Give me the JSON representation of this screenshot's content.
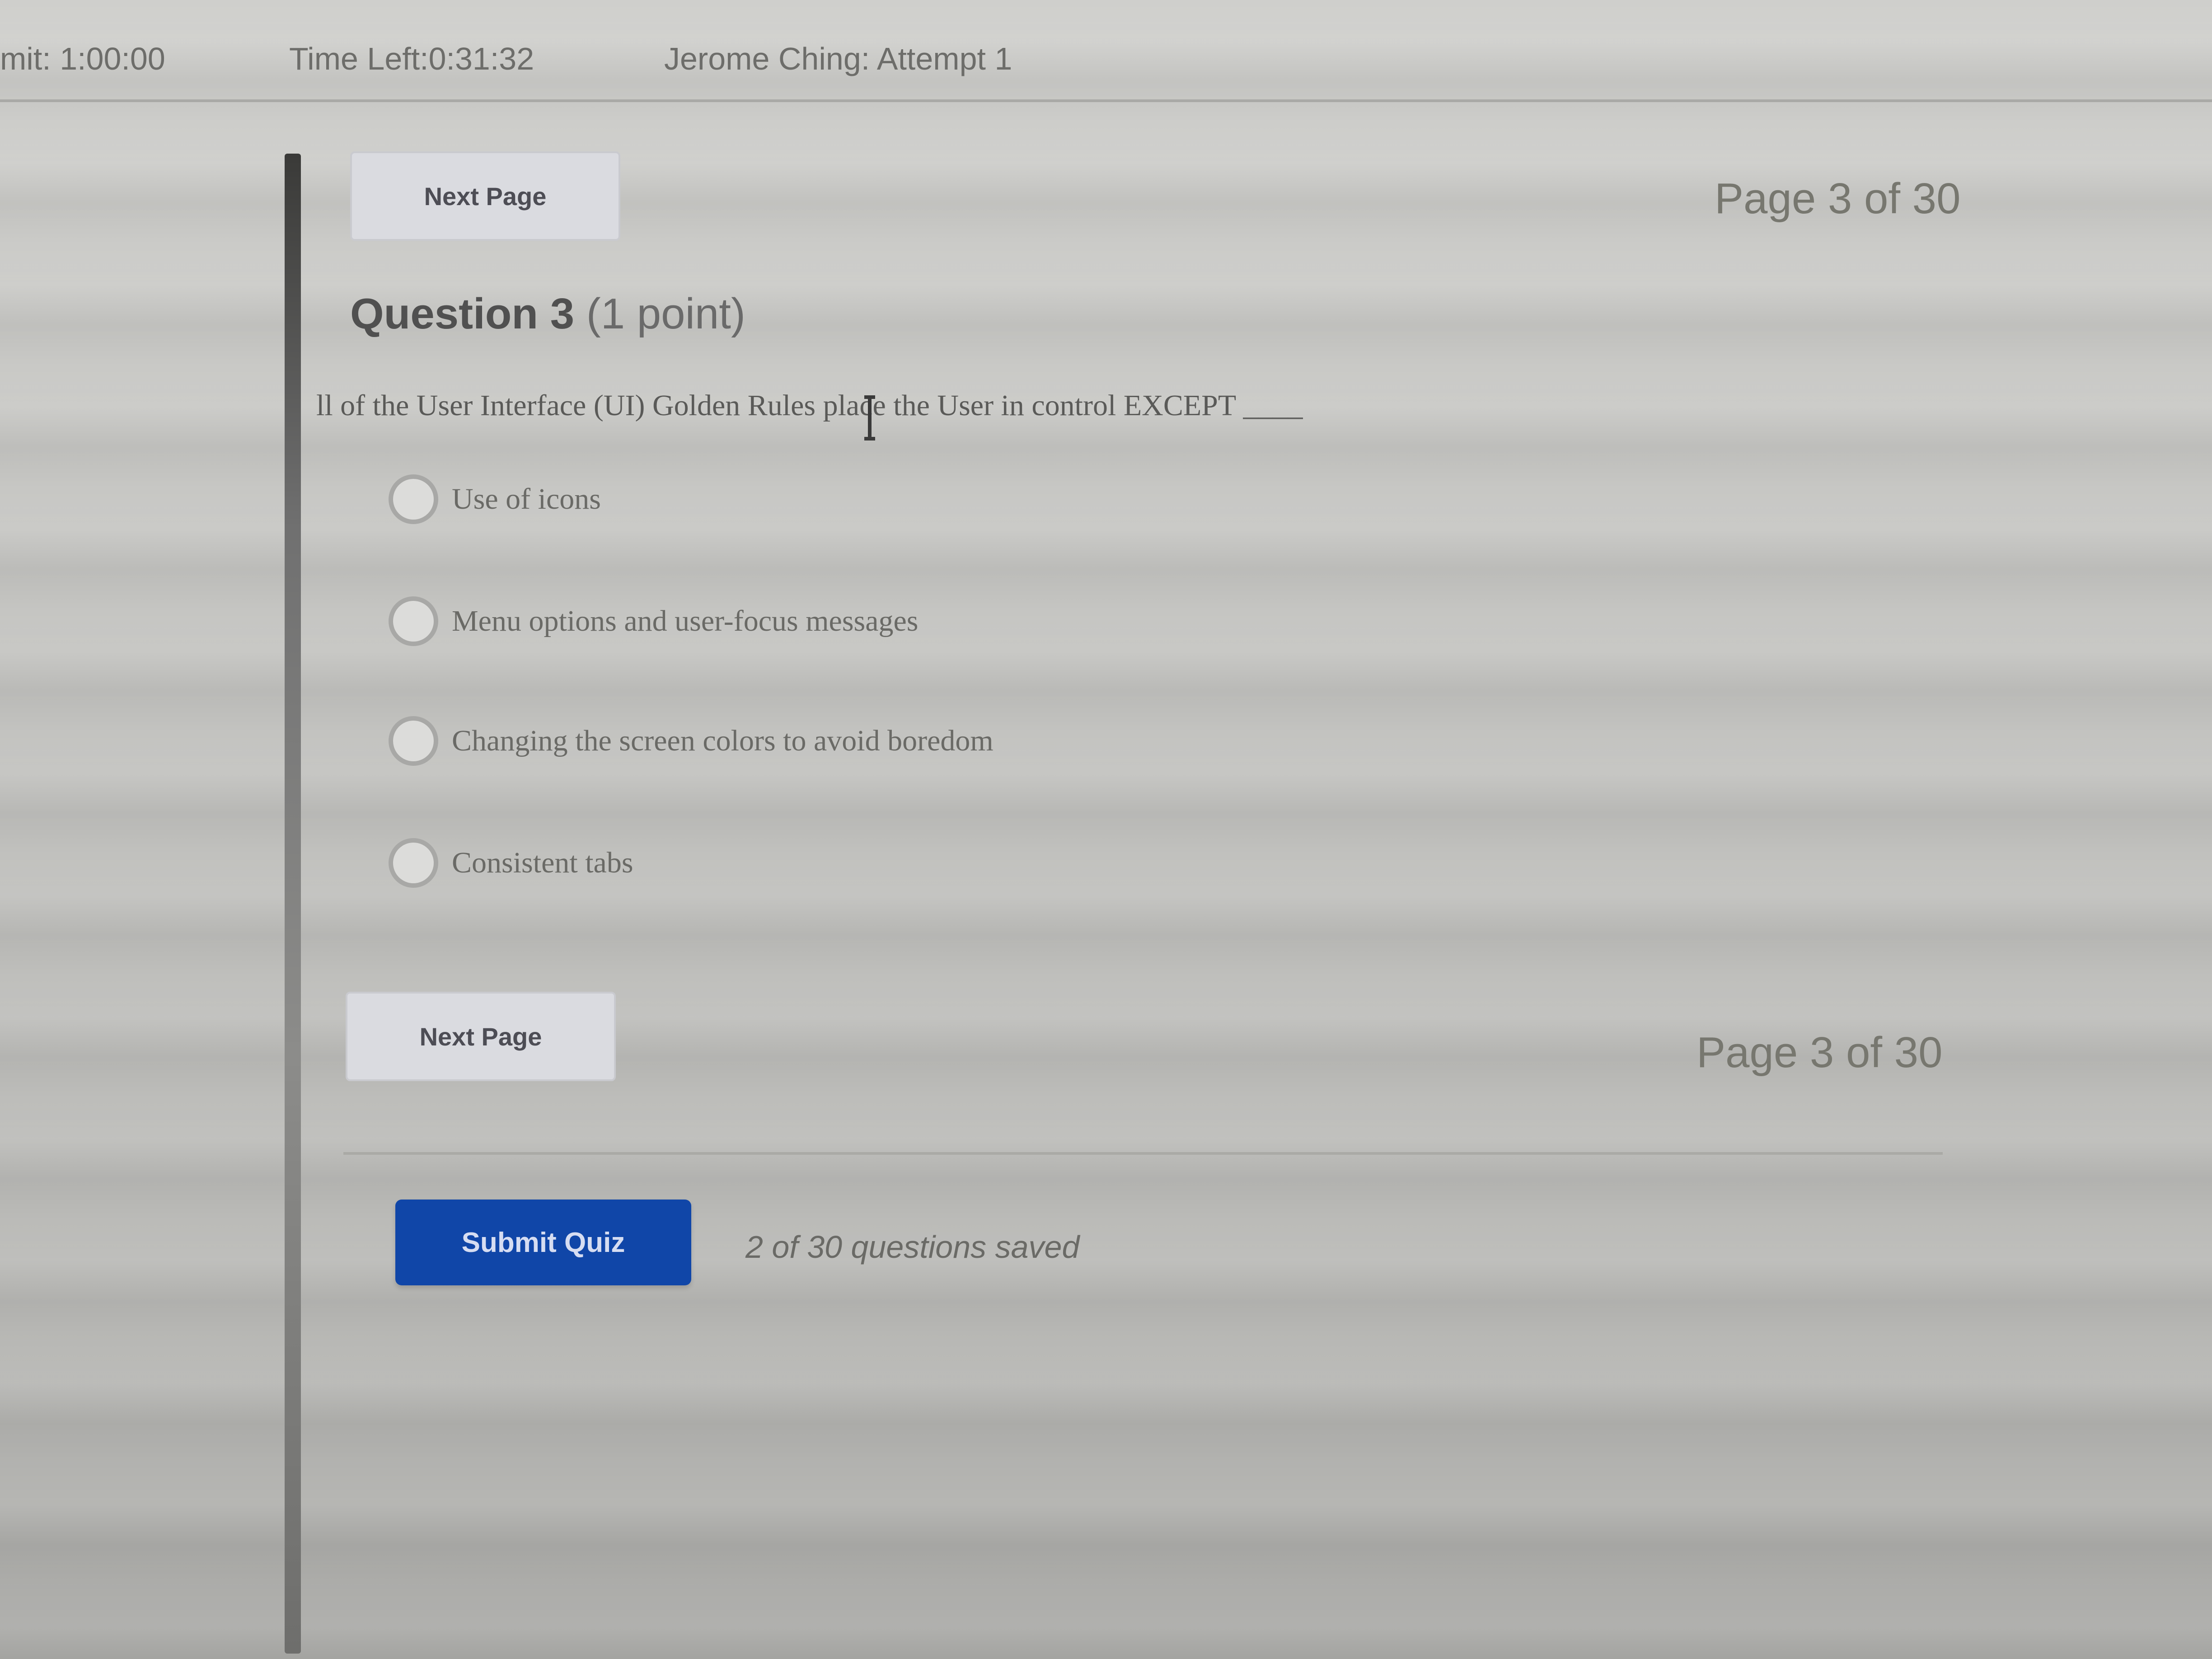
{
  "header": {
    "time_limit": "mit: 1:00:00",
    "time_left": "Time Left:0:31:32",
    "attempt": "Jerome Ching: Attempt 1"
  },
  "nav_top": {
    "next_page_label": "Next Page",
    "page_indicator": "Page 3 of 30"
  },
  "question": {
    "title": "Question 3",
    "points": "(1 point)",
    "text": "ll of the User Interface (UI) Golden Rules place the User in control  EXCEPT ____",
    "options": [
      {
        "label": "Use of icons",
        "selected": false
      },
      {
        "label": "Menu options and user-focus messages",
        "selected": false
      },
      {
        "label": "Changing the screen colors to avoid boredom",
        "selected": false
      },
      {
        "label": "Consistent tabs",
        "selected": false
      }
    ]
  },
  "nav_bottom": {
    "next_page_label": "Next Page",
    "page_indicator": "Page 3 of 30"
  },
  "footer": {
    "submit_label": "Submit Quiz",
    "saved_status": "2 of 30 questions saved"
  },
  "colors": {
    "submit_button": "#1046a8",
    "next_button": "#dadbe0",
    "background": "#c9c9c6"
  },
  "icons": {
    "cursor": "text-cursor-icon",
    "radio": "radio-button-icon"
  }
}
